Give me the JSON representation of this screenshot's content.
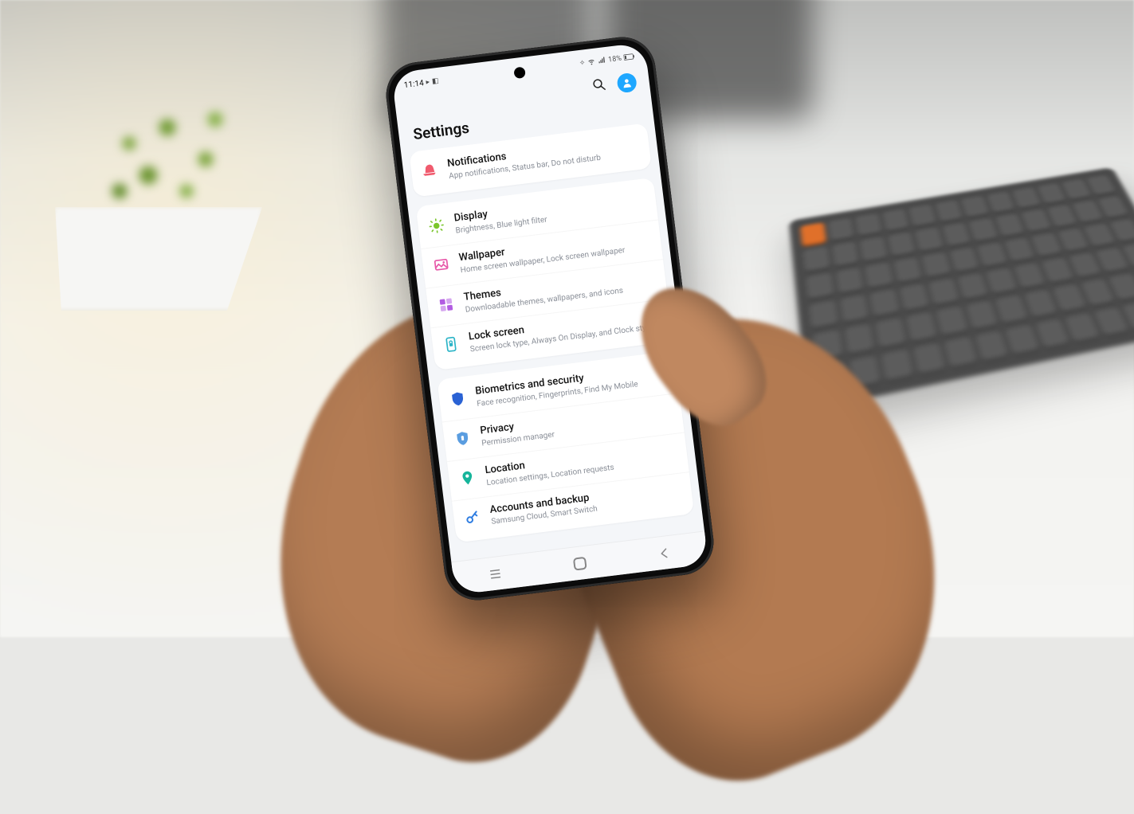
{
  "status_bar": {
    "time": "11:14",
    "battery_text": "18%"
  },
  "header": {
    "title": "Settings"
  },
  "groups": [
    {
      "items": [
        {
          "label": "Notifications",
          "sub": "App notifications, Status bar, Do not disturb",
          "icon": "notifications-icon",
          "color": "#f05b6e"
        }
      ]
    },
    {
      "items": [
        {
          "label": "Display",
          "sub": "Brightness, Blue light filter",
          "icon": "display-icon",
          "color": "#7bc62d"
        },
        {
          "label": "Wallpaper",
          "sub": "Home screen wallpaper, Lock screen wallpaper",
          "icon": "wallpaper-icon",
          "color": "#e756a8"
        },
        {
          "label": "Themes",
          "sub": "Downloadable themes, wallpapers, and icons",
          "icon": "themes-icon",
          "color": "#b25ce2"
        },
        {
          "label": "Lock screen",
          "sub": "Screen lock type, Always On Display, and Clock style",
          "icon": "lock-screen-icon",
          "color": "#2bb4c7"
        }
      ]
    },
    {
      "items": [
        {
          "label": "Biometrics and security",
          "sub": "Face recognition, Fingerprints, Find My Mobile",
          "icon": "shield-icon",
          "color": "#2a62d4"
        },
        {
          "label": "Privacy",
          "sub": "Permission manager",
          "icon": "privacy-icon",
          "color": "#5a9de0"
        },
        {
          "label": "Location",
          "sub": "Location settings, Location requests",
          "icon": "location-icon",
          "color": "#16b59b"
        },
        {
          "label": "Accounts and backup",
          "sub": "Samsung Cloud, Smart Switch",
          "icon": "key-icon",
          "color": "#2f7de1"
        }
      ]
    }
  ]
}
